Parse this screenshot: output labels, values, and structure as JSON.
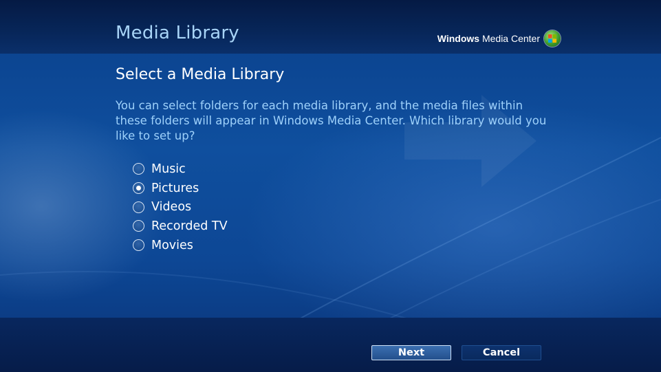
{
  "header": {
    "title": "Media Library",
    "brand_bold": "Windows",
    "brand_rest": "Media Center",
    "brand_icon": "windows-flag-orb-icon"
  },
  "main": {
    "heading": "Select a Media Library",
    "description": "You can select folders for each media library, and the media files within these folders will appear in Windows Media Center.  Which library would you like to set up?",
    "options": [
      {
        "label": "Music",
        "selected": false
      },
      {
        "label": "Pictures",
        "selected": true
      },
      {
        "label": "Videos",
        "selected": false
      },
      {
        "label": "Recorded TV",
        "selected": false
      },
      {
        "label": "Movies",
        "selected": false
      }
    ]
  },
  "footer": {
    "next_label": "Next",
    "cancel_label": "Cancel"
  },
  "colors": {
    "title": "#a8d4f7",
    "description": "#9ed1fb",
    "background": "#0f4f9e"
  }
}
